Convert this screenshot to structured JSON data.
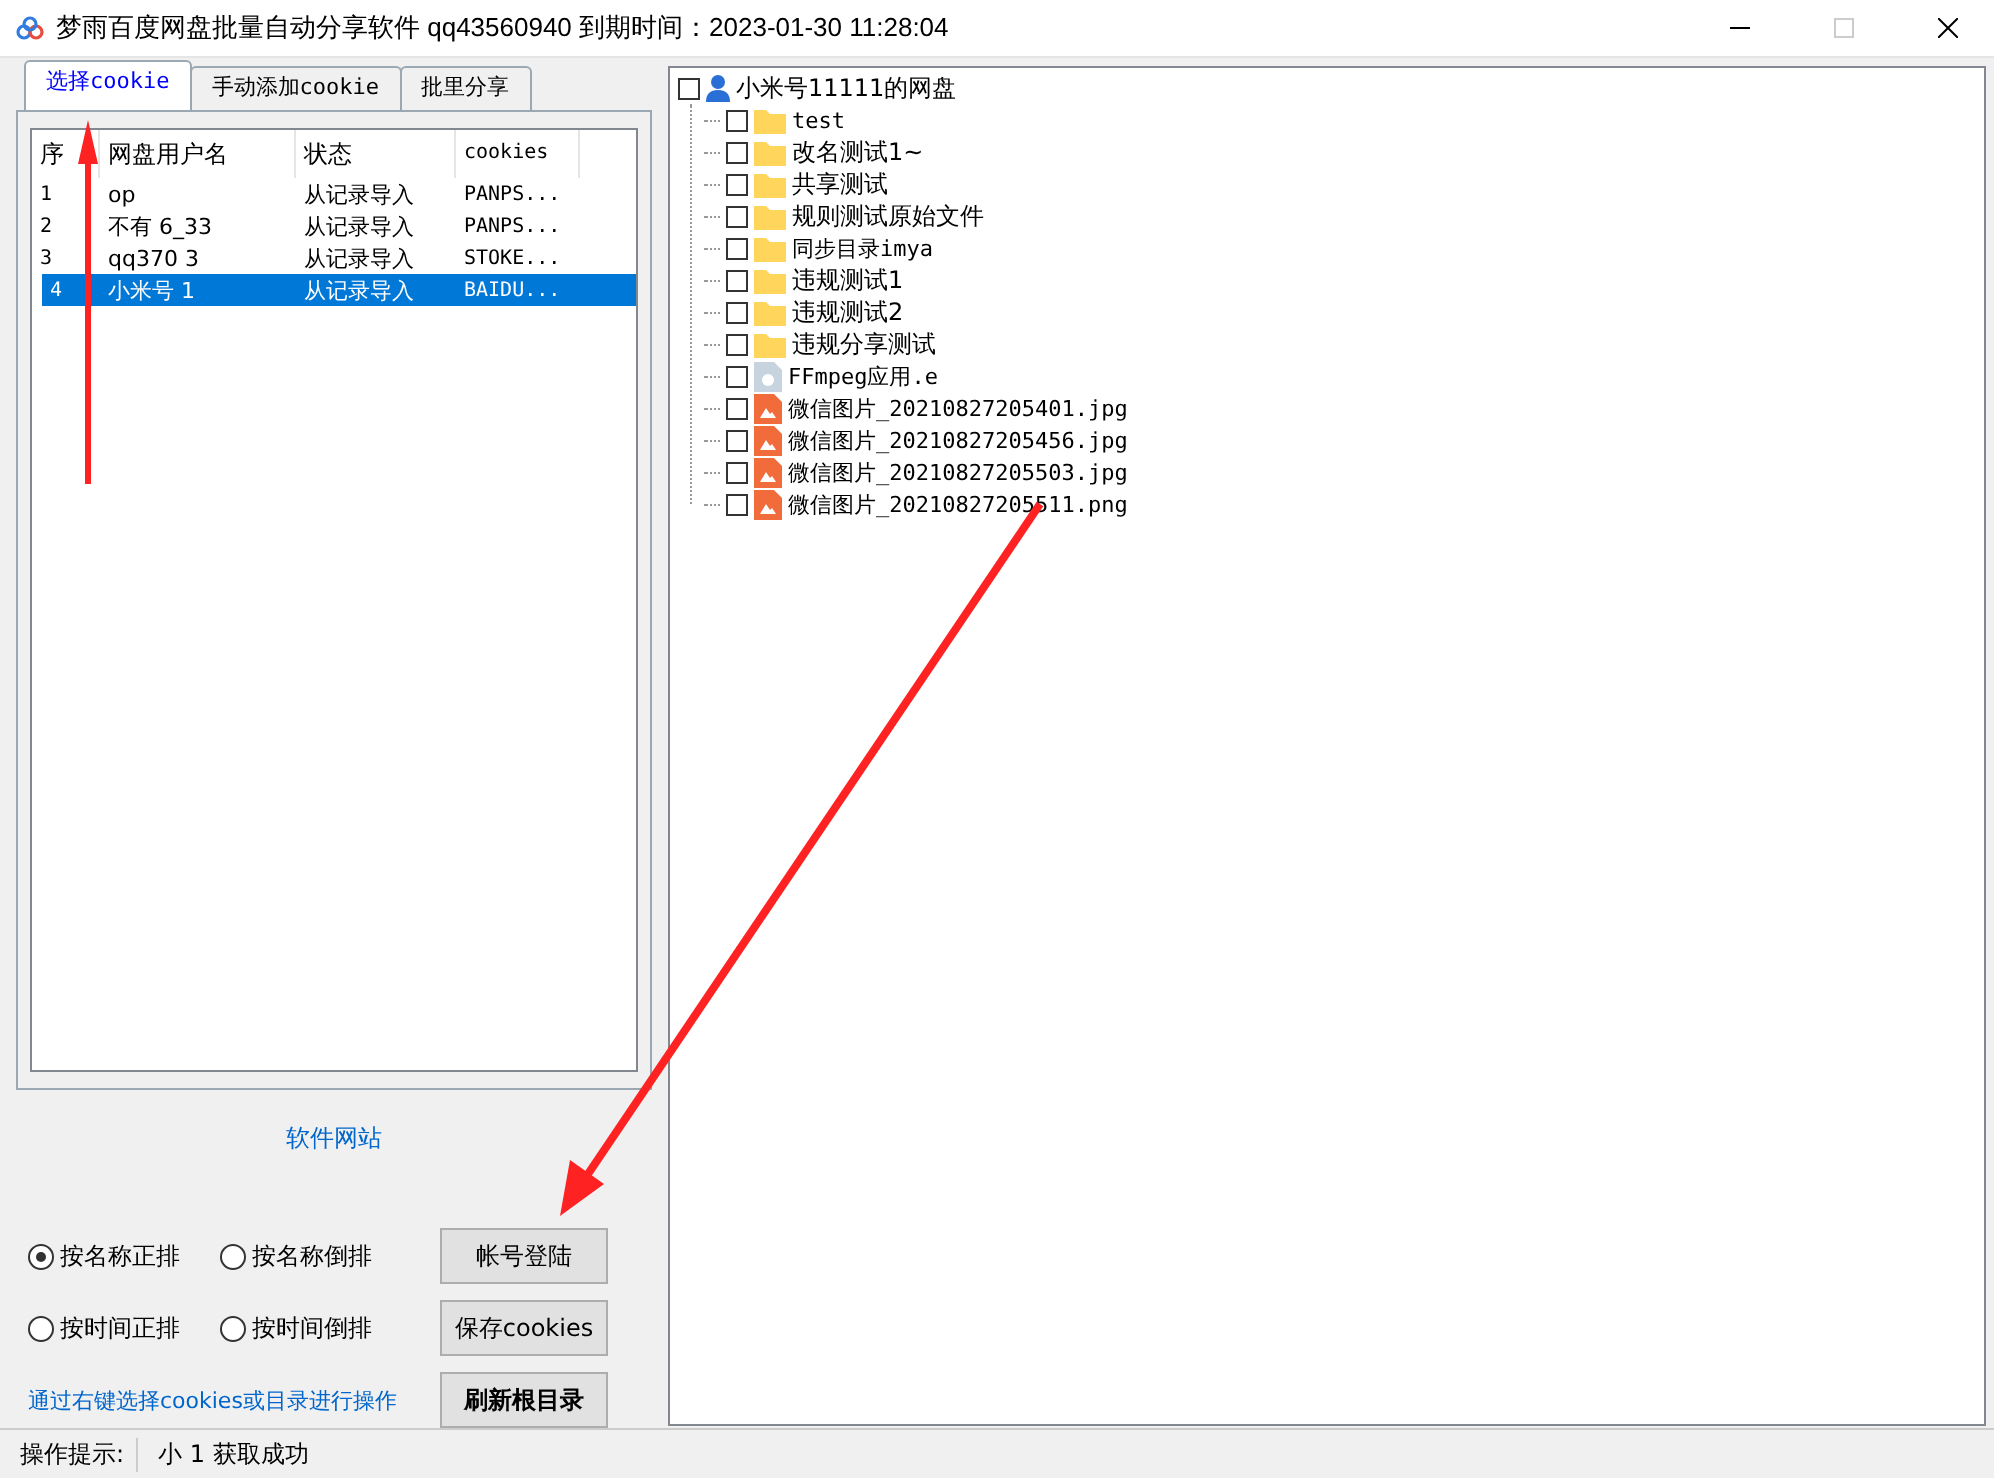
{
  "window": {
    "title": "梦雨百度网盘批量自动分享软件 qq43560940 到期时间：2023-01-30 11:28:04"
  },
  "tabs": [
    {
      "label": "选择cookie",
      "selected": true
    },
    {
      "label": "手动添加cookie",
      "selected": false
    },
    {
      "label": "批里分享",
      "selected": false
    }
  ],
  "table": {
    "columns": [
      "序",
      "网盘用户名",
      "状态",
      "cookies"
    ],
    "rows": [
      {
        "cells": [
          "1",
          "op",
          "从记录导入",
          "PANPS..."
        ],
        "selected": false
      },
      {
        "cells": [
          "2",
          "不有 6_33",
          "从记录导入",
          "PANPS..."
        ],
        "selected": false
      },
      {
        "cells": [
          "3",
          "qq370 3",
          "从记录导入",
          "STOKE..."
        ],
        "selected": false
      },
      {
        "cells": [
          "4",
          "小米号 1",
          "从记录导入",
          "BAIDU..."
        ],
        "selected": true
      }
    ]
  },
  "website_link": "软件网站",
  "sort_options": [
    {
      "label": "按名称正排",
      "selected": true
    },
    {
      "label": "按名称倒排",
      "selected": false
    },
    {
      "label": "按时间正排",
      "selected": false
    },
    {
      "label": "按时间倒排",
      "selected": false
    }
  ],
  "buttons": [
    "帐号登陆",
    "保存cookies",
    "刷新根目录"
  ],
  "hint": "通过右键选择cookies或目录进行操作",
  "tree": {
    "label": "小米号11111的网盘",
    "checked": false,
    "children": [
      {
        "label": "test",
        "kind": "folder",
        "checked": false
      },
      {
        "label": "改名测试1~",
        "kind": "folder",
        "checked": false
      },
      {
        "label": "共享测试",
        "kind": "folder",
        "checked": false
      },
      {
        "label": "规则测试原始文件",
        "kind": "folder",
        "checked": false
      },
      {
        "label": "同步目录imya",
        "kind": "folder",
        "checked": false
      },
      {
        "label": "违规测试1",
        "kind": "folder",
        "checked": false
      },
      {
        "label": "违规测试2",
        "kind": "folder",
        "checked": false
      },
      {
        "label": "违规分享测试",
        "kind": "folder",
        "checked": false
      },
      {
        "label": "FFmpeg应用.e",
        "kind": "file",
        "checked": false
      },
      {
        "label": "微信图片_20210827205401.jpg",
        "kind": "image",
        "checked": false
      },
      {
        "label": "微信图片_20210827205456.jpg",
        "kind": "image",
        "checked": false
      },
      {
        "label": "微信图片_20210827205503.jpg",
        "kind": "image",
        "checked": false
      },
      {
        "label": "微信图片_20210827205511.png",
        "kind": "image",
        "checked": false
      }
    ]
  },
  "status_bar": {
    "label": "操作提示:",
    "message": "小 1 获取成功"
  }
}
